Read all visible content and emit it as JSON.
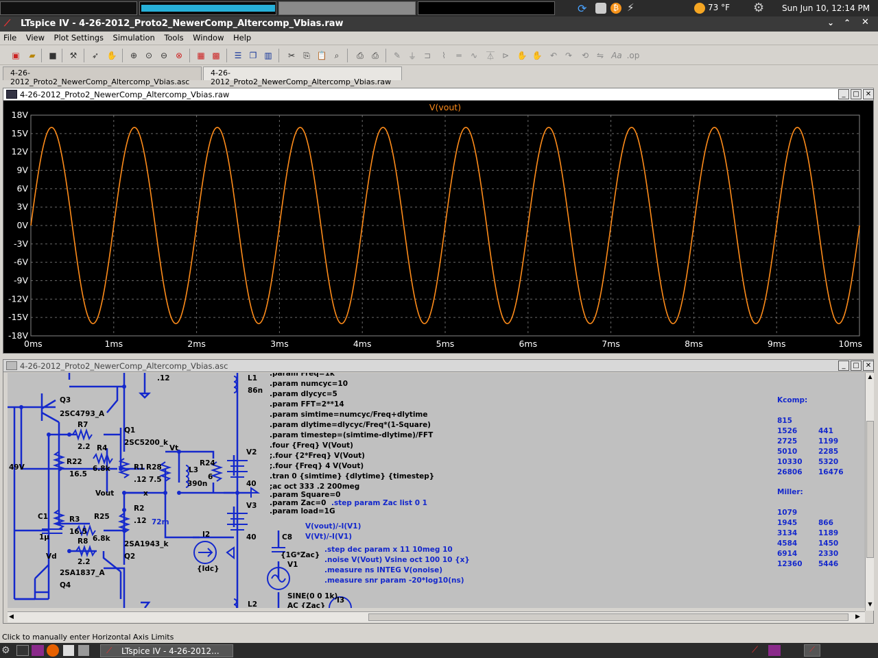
{
  "topbar": {
    "weather": "73 °F",
    "clock": "Sun Jun 10, 12:14 PM"
  },
  "window": {
    "title": "LTspice IV - 4-26-2012_Proto2_NewerComp_Altercomp_Vbias.raw"
  },
  "menu": [
    "File",
    "View",
    "Plot Settings",
    "Simulation",
    "Tools",
    "Window",
    "Help"
  ],
  "tabs": [
    {
      "label": "4-26-2012_Proto2_NewerComp_Altercomp_Vbias.asc",
      "active": false
    },
    {
      "label": "4-26-2012_Proto2_NewerComp_Altercomp_Vbias.raw",
      "active": true
    }
  ],
  "plot_window": {
    "title": "4-26-2012_Proto2_NewerComp_Altercomp_Vbias.raw"
  },
  "chart_data": {
    "type": "line",
    "title": "V(vout)",
    "xlabel": "",
    "ylabel": "",
    "x_range": [
      0,
      10
    ],
    "x_unit": "ms",
    "y_range": [
      -18,
      18
    ],
    "y_unit": "V",
    "x_ticks": [
      "0ms",
      "1ms",
      "2ms",
      "3ms",
      "4ms",
      "5ms",
      "6ms",
      "7ms",
      "8ms",
      "9ms",
      "10ms"
    ],
    "y_ticks": [
      "18V",
      "15V",
      "12V",
      "9V",
      "6V",
      "3V",
      "0V",
      "-3V",
      "-6V",
      "-9V",
      "-12V",
      "-15V",
      "-18V"
    ],
    "grid": true,
    "background": "#000000",
    "trace_color": "#ff8c1a",
    "series": [
      {
        "name": "V(vout)",
        "function": "sine",
        "amplitude": 16,
        "frequency_khz": 1,
        "phase_deg": 0
      }
    ]
  },
  "schematic_window": {
    "title": "4-26-2012_Proto2_NewerComp_Altercomp_Vbias.asc"
  },
  "schematic": {
    "labels": [
      "Q3",
      "2SC4793_A",
      "R7",
      "2.2",
      "R4",
      "6.8k",
      "Q1",
      "2SC5200_k",
      "R22",
      "16.5",
      "R1",
      ".12",
      "49V",
      "Vout",
      "x",
      "R28",
      "7.5",
      "L3",
      "390n",
      "R24",
      "6",
      "V2",
      "40",
      "V3",
      "40",
      "C1",
      "1µ",
      "R3",
      "16.5",
      "R25",
      "6.8k",
      "R2",
      ".12",
      "72m",
      "I2",
      "{Idc}",
      "2SA1943_k",
      "Q2",
      "R8",
      "2.2",
      "Vd",
      "2SA1837_A",
      "Q4",
      ".12",
      "L1",
      "86n",
      "L2",
      "Vt",
      "C8",
      "{1G*Zac}",
      "V1",
      "SINE(0 0 1k)",
      "AC {Zac}",
      "I3"
    ],
    "directives": [
      ".param Freq=1k",
      ".param numcyc=10",
      ".param dlycyc=5",
      ".param FFT=2**14",
      ".param simtime=numcyc/Freq+dlytime",
      ".param dlytime=dlycyc/Freq*(1-Square)",
      ".param timestep=(simtime-dlytime)/FFT",
      ".four {Freq} V(Vout)",
      ";.four {2*Freq} V(Vout)",
      ";.four {Freq} 4 V(Vout)",
      ".tran 0 {simtime} {dlytime} {timestep}",
      ";ac oct 333 .2 200meg",
      ".param Square=0",
      ".param Zac=0",
      ".param load=1G"
    ],
    "blue_directives": [
      ".step param Zac list 0 1",
      "V(vout)/-I(V1)",
      "V(Vt)/-I(V1)",
      ".step dec param x 11 10meg 10",
      ".noise V(Vout) Vsine oct 100 10 {x}",
      ".measure ns INTEG V(onoise)",
      ".measure snr param -20*log10(ns)"
    ],
    "kcomp_title": "Kcomp:",
    "kcomp": [
      [
        "815",
        ""
      ],
      [
        "1526",
        "441"
      ],
      [
        "2725",
        "1199"
      ],
      [
        "5010",
        "2285"
      ],
      [
        "10330",
        "5320"
      ],
      [
        "26806",
        "16476"
      ]
    ],
    "miller_title": "Miller:",
    "miller": [
      [
        "1079",
        ""
      ],
      [
        "1945",
        "866"
      ],
      [
        "3134",
        "1189"
      ],
      [
        "4584",
        "1450"
      ],
      [
        "6914",
        "2330"
      ],
      [
        "12360",
        "5446"
      ]
    ]
  },
  "status": {
    "text": "Click to manually enter Horizontal Axis Limits"
  },
  "taskbar": {
    "item": "LTspice IV - 4-26-2012..."
  }
}
